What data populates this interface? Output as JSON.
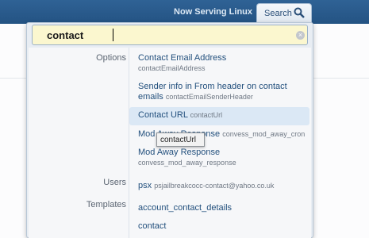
{
  "header": {
    "serving_label": "Now Serving Linux",
    "search_tab_label": "Search"
  },
  "search": {
    "value": "contact",
    "clear_icon": "clear-icon"
  },
  "sections": {
    "options_label": "Options",
    "users_label": "Users",
    "templates_label": "Templates"
  },
  "options": [
    {
      "title": "Contact Email Address",
      "sub": "contactEmailAddress"
    },
    {
      "title": "Sender info in From header on contact",
      "title2": "emails",
      "sub": "contactEmailSenderHeader"
    },
    {
      "title": "Contact URL",
      "sub": "contactUrl"
    },
    {
      "title": "Mod Away Response",
      "sub": "convess_mod_away_cron"
    },
    {
      "title": "Mod Away Response",
      "sub": "convess_mod_away_response"
    }
  ],
  "users": [
    {
      "title": "psx",
      "sub": "psjailbreakcocc-contact@yahoo.co.uk"
    }
  ],
  "templates": [
    {
      "title": "account_contact_details"
    },
    {
      "title": "contact"
    }
  ],
  "tooltip": "contactUrl",
  "colors": {
    "topbar": "#2a5b8c",
    "input_bg": "#fbf7cf",
    "highlight": "#dbe8f5"
  }
}
